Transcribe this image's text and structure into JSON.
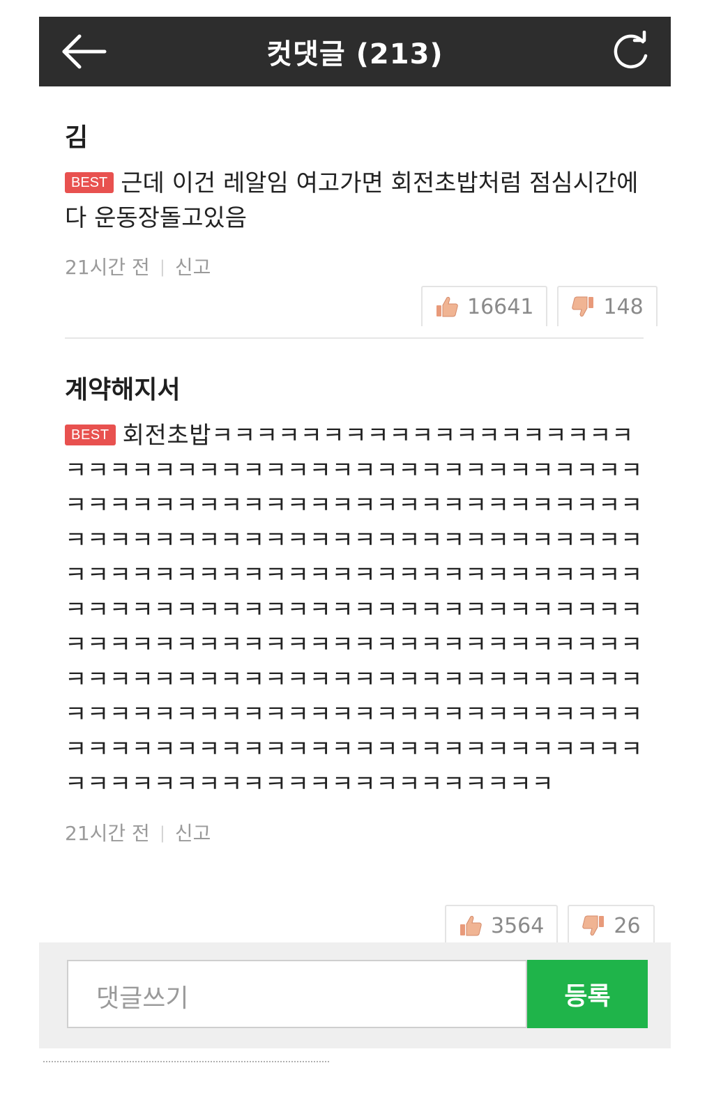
{
  "header": {
    "title": "컷댓글 (213)",
    "back_icon": "arrow-left-icon",
    "refresh_icon": "refresh-icon"
  },
  "comments": [
    {
      "author": "김",
      "badge": "BEST",
      "text": "근데 이건 레알임 여고가면 회전초밥처럼 점심시간에 다 운동장돌고있음",
      "time": "21시간 전",
      "report": "신고",
      "likes": "16641",
      "dislikes": "148"
    },
    {
      "author": "계약해지서",
      "badge": "BEST",
      "text": "회전초밥ㅋㅋㅋㅋㅋㅋㅋㅋㅋㅋㅋㅋㅋㅋㅋㅋㅋㅋㅋㅋㅋㅋㅋㅋㅋㅋㅋㅋㅋㅋㅋㅋㅋㅋㅋㅋㅋㅋㅋㅋㅋㅋㅋㅋㅋㅋㅋㅋㅋㅋㅋㅋㅋㅋㅋㅋㅋㅋㅋㅋㅋㅋㅋㅋㅋㅋㅋㅋㅋㅋㅋㅋㅋㅋㅋㅋㅋㅋㅋㅋㅋㅋㅋㅋㅋㅋㅋㅋㅋㅋㅋㅋㅋㅋㅋㅋㅋㅋㅋㅋㅋㅋㅋㅋㅋㅋㅋㅋㅋㅋㅋㅋㅋㅋㅋㅋㅋㅋㅋㅋㅋㅋㅋㅋㅋㅋㅋㅋㅋㅋㅋㅋㅋㅋㅋㅋㅋㅋㅋㅋㅋㅋㅋㅋㅋㅋㅋㅋㅋㅋㅋㅋㅋㅋㅋㅋㅋㅋㅋㅋㅋㅋㅋㅋㅋㅋㅋㅋㅋㅋㅋㅋㅋㅋㅋㅋㅋㅋㅋㅋㅋㅋㅋㅋㅋㅋㅋㅋㅋㅋㅋㅋㅋㅋㅋㅋㅋㅋㅋㅋㅋㅋㅋㅋㅋㅋㅋㅋㅋㅋㅋㅋㅋㅋㅋㅋㅋㅋㅋㅋㅋㅋㅋㅋㅋㅋㅋㅋㅋㅋㅋㅋㅋㅋㅋㅋㅋㅋㅋㅋㅋㅋㅋㅋㅋㅋㅋㅋㅋㅋㅋㅋㅋㅋㅋㅋㅋㅋㅋㅋㅋㅋㅋㅋㅋㅋㅋㅋㅋㅋㅋㅋㅋㅋㅋ",
      "time": "21시간 전",
      "report": "신고",
      "likes": "3564",
      "dislikes": "26"
    }
  ],
  "compose": {
    "placeholder": "댓글쓰기",
    "submit_label": "등록"
  },
  "colors": {
    "header_bg": "#2d2d2d",
    "best_badge": "#e8514f",
    "submit_button": "#1fb44a"
  }
}
